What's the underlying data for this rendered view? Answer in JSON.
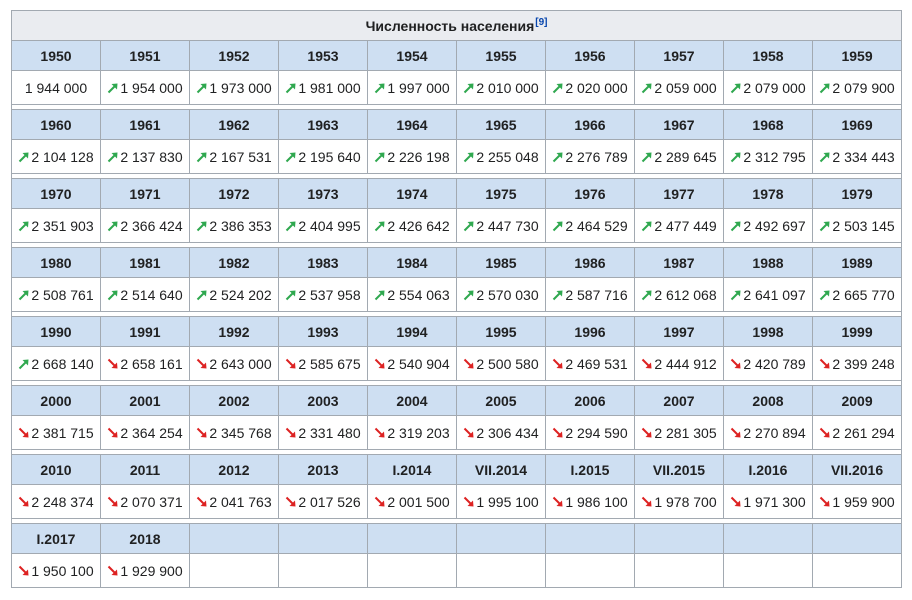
{
  "caption": "Численность населения",
  "caption_ref": "[9]",
  "colors": {
    "header_bg": "#cedff2",
    "caption_bg": "#eaecf0",
    "up": "#2fa84f",
    "down": "#dd2222",
    "ref_link": "#0645ad"
  },
  "rows": [
    {
      "years": [
        "1950",
        "1951",
        "1952",
        "1953",
        "1954",
        "1955",
        "1956",
        "1957",
        "1958",
        "1959"
      ],
      "values": [
        "1 944 000",
        "1 954 000",
        "1 973 000",
        "1 981 000",
        "1 997 000",
        "2 010 000",
        "2 020 000",
        "2 059 000",
        "2 079 000",
        "2 079 900"
      ],
      "trend": [
        "none",
        "up",
        "up",
        "up",
        "up",
        "up",
        "up",
        "up",
        "up",
        "up"
      ]
    },
    {
      "years": [
        "1960",
        "1961",
        "1962",
        "1963",
        "1964",
        "1965",
        "1966",
        "1967",
        "1968",
        "1969"
      ],
      "values": [
        "2 104 128",
        "2 137 830",
        "2 167 531",
        "2 195 640",
        "2 226 198",
        "2 255 048",
        "2 276 789",
        "2 289 645",
        "2 312 795",
        "2 334 443"
      ],
      "trend": [
        "up",
        "up",
        "up",
        "up",
        "up",
        "up",
        "up",
        "up",
        "up",
        "up"
      ]
    },
    {
      "years": [
        "1970",
        "1971",
        "1972",
        "1973",
        "1974",
        "1975",
        "1976",
        "1977",
        "1978",
        "1979"
      ],
      "values": [
        "2 351 903",
        "2 366 424",
        "2 386 353",
        "2 404 995",
        "2 426 642",
        "2 447 730",
        "2 464 529",
        "2 477 449",
        "2 492 697",
        "2 503 145"
      ],
      "trend": [
        "up",
        "up",
        "up",
        "up",
        "up",
        "up",
        "up",
        "up",
        "up",
        "up"
      ]
    },
    {
      "years": [
        "1980",
        "1981",
        "1982",
        "1983",
        "1984",
        "1985",
        "1986",
        "1987",
        "1988",
        "1989"
      ],
      "values": [
        "2 508 761",
        "2 514 640",
        "2 524 202",
        "2 537 958",
        "2 554 063",
        "2 570 030",
        "2 587 716",
        "2 612 068",
        "2 641 097",
        "2 665 770"
      ],
      "trend": [
        "up",
        "up",
        "up",
        "up",
        "up",
        "up",
        "up",
        "up",
        "up",
        "up"
      ]
    },
    {
      "years": [
        "1990",
        "1991",
        "1992",
        "1993",
        "1994",
        "1995",
        "1996",
        "1997",
        "1998",
        "1999"
      ],
      "values": [
        "2 668 140",
        "2 658 161",
        "2 643 000",
        "2 585 675",
        "2 540 904",
        "2 500 580",
        "2 469 531",
        "2 444 912",
        "2 420 789",
        "2 399 248"
      ],
      "trend": [
        "up",
        "down",
        "down",
        "down",
        "down",
        "down",
        "down",
        "down",
        "down",
        "down"
      ]
    },
    {
      "years": [
        "2000",
        "2001",
        "2002",
        "2003",
        "2004",
        "2005",
        "2006",
        "2007",
        "2008",
        "2009"
      ],
      "values": [
        "2 381 715",
        "2 364 254",
        "2 345 768",
        "2 331 480",
        "2 319 203",
        "2 306 434",
        "2 294 590",
        "2 281 305",
        "2 270 894",
        "2 261 294"
      ],
      "trend": [
        "down",
        "down",
        "down",
        "down",
        "down",
        "down",
        "down",
        "down",
        "down",
        "down"
      ]
    },
    {
      "years": [
        "2010",
        "2011",
        "2012",
        "2013",
        "I.2014",
        "VII.2014",
        "I.2015",
        "VII.2015",
        "I.2016",
        "VII.2016"
      ],
      "values": [
        "2 248 374",
        "2 070 371",
        "2 041 763",
        "2 017 526",
        "2 001 500",
        "1 995 100",
        "1 986 100",
        "1 978 700",
        "1 971 300",
        "1 959 900"
      ],
      "trend": [
        "down",
        "down",
        "down",
        "down",
        "down",
        "down",
        "down",
        "down",
        "down",
        "down"
      ]
    },
    {
      "years": [
        "I.2017",
        "2018",
        "",
        "",
        "",
        "",
        "",
        "",
        "",
        ""
      ],
      "values": [
        "1 950 100",
        "1 929 900",
        "",
        "",
        "",
        "",
        "",
        "",
        "",
        ""
      ],
      "trend": [
        "down",
        "down",
        "none",
        "none",
        "none",
        "none",
        "none",
        "none",
        "none",
        "none"
      ]
    }
  ]
}
